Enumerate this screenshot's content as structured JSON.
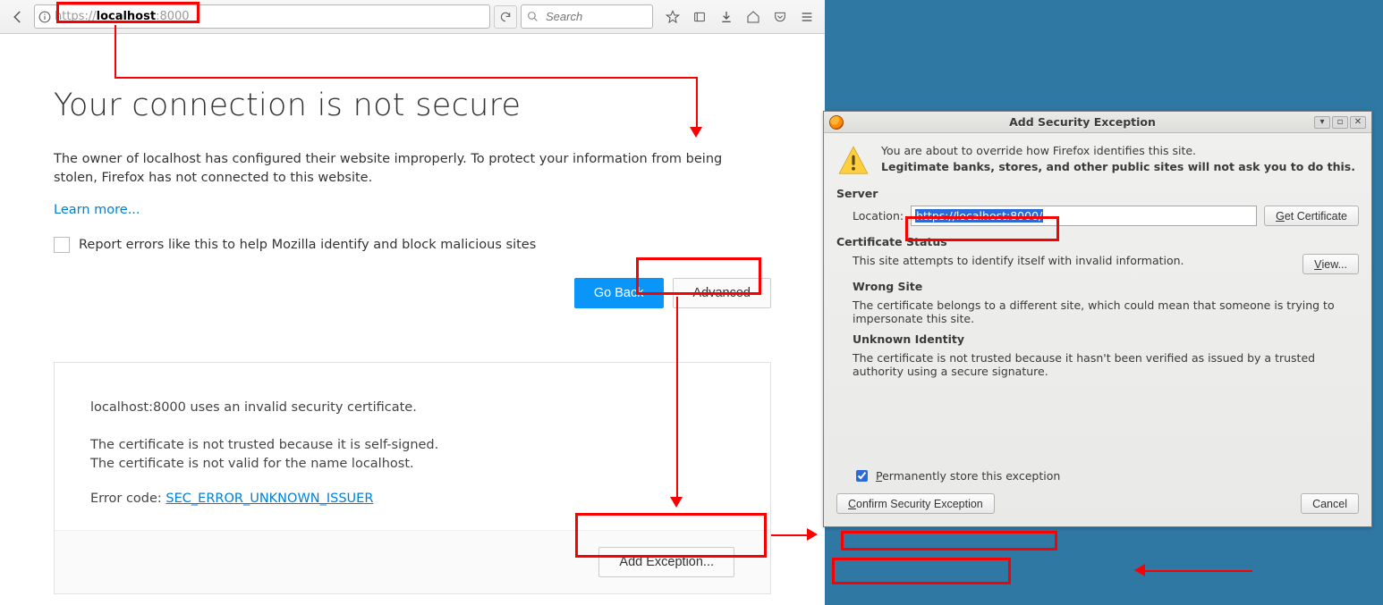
{
  "toolbar": {
    "url_prefix": "https://",
    "url_host": "localhost",
    "url_suffix": ":8000",
    "search_placeholder": "Search"
  },
  "page": {
    "heading": "Your connection is not secure",
    "lead": "The owner of localhost has configured their website improperly. To protect your information from being stolen, Firefox has not connected to this website.",
    "learn_more": "Learn more...",
    "report_checkbox": "Report errors like this to help Mozilla identify and block malicious sites",
    "go_back": "Go Back",
    "advanced": "Advanced"
  },
  "errbox": {
    "line1": "localhost:8000 uses an invalid security certificate.",
    "line2": "The certificate is not trusted because it is self-signed.",
    "line3": "The certificate is not valid for the name localhost.",
    "code_label": "Error code: ",
    "code": "SEC_ERROR_UNKNOWN_ISSUER",
    "add_exception": "Add Exception..."
  },
  "dialog": {
    "title": "Add Security Exception",
    "warn1": "You are about to override how Firefox identifies this site.",
    "warn2": "Legitimate banks, stores, and other public sites will not ask you to do this.",
    "server_hdr": "Server",
    "location_label": "Location:",
    "location_value": "https://localhost:8000/",
    "get_cert": "Get Certificate",
    "cert_status_hdr": "Certificate Status",
    "cert_status_txt": "This site attempts to identify itself with invalid information.",
    "view": "View...",
    "wrong_site_hdr": "Wrong Site",
    "wrong_site_txt": "The certificate belongs to a different site, which could mean that someone is trying to impersonate this site.",
    "unknown_hdr": "Unknown Identity",
    "unknown_txt": "The certificate is not trusted because it hasn't been verified as issued by a trusted authority using a secure signature.",
    "perm_label": "Permanently store this exception",
    "confirm": "Confirm Security Exception",
    "cancel": "Cancel"
  }
}
